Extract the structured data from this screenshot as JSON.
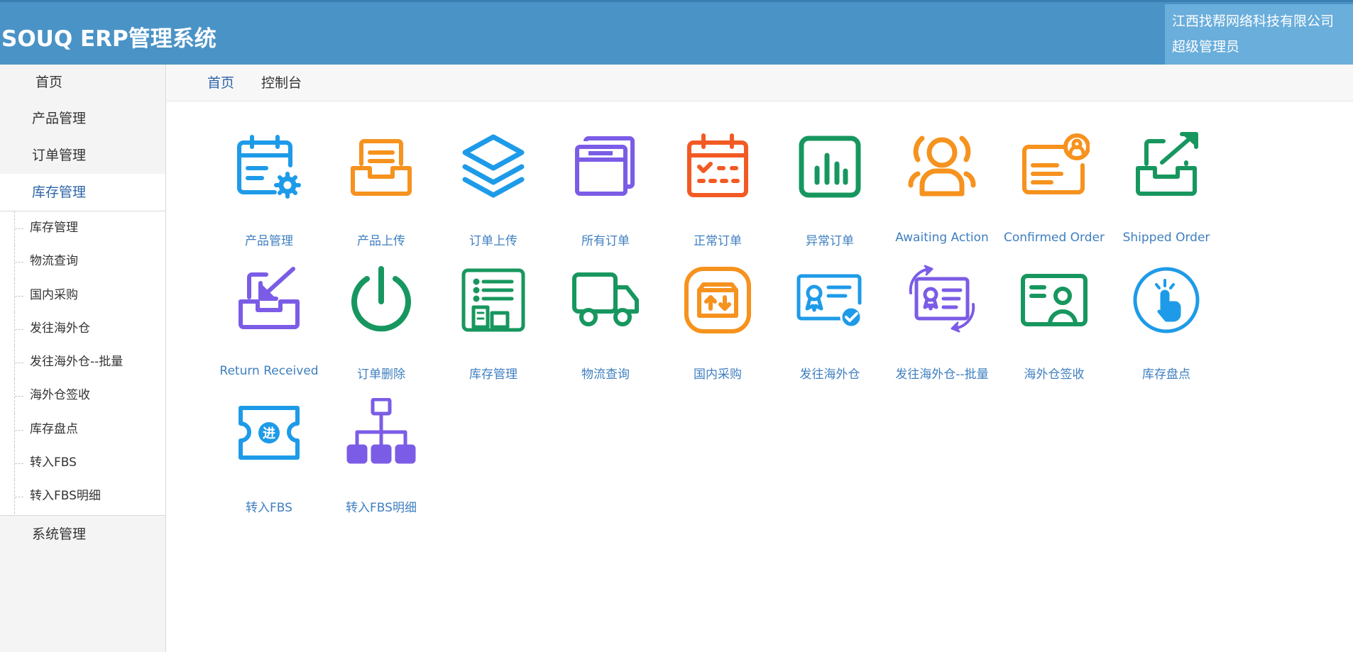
{
  "header": {
    "title": "SOUQ ERP管理系统",
    "company": "江西找帮网络科技有限公司",
    "role": "超级管理员"
  },
  "sidebar": {
    "items": [
      {
        "label": "首页"
      },
      {
        "label": "产品管理"
      },
      {
        "label": "订单管理"
      },
      {
        "label": "库存管理"
      },
      {
        "label": "系统管理"
      }
    ],
    "submenu": [
      "库存管理",
      "物流查询",
      "国内采购",
      "发往海外仓",
      "发往海外仓--批量",
      "海外仓签收",
      "库存盘点",
      "转入FBS",
      "转入FBS明细"
    ]
  },
  "breadcrumb": {
    "home": "首页",
    "current": "控制台"
  },
  "tiles": [
    {
      "label": "产品管理",
      "icon": "calendar-gear-icon",
      "color": "#1e9be8"
    },
    {
      "label": "产品上传",
      "icon": "inbox-tray-icon",
      "color": "#f6921e"
    },
    {
      "label": "订单上传",
      "icon": "layers-icon",
      "color": "#1e9be8"
    },
    {
      "label": "所有订单",
      "icon": "windows-stack-icon",
      "color": "#7b5ce6"
    },
    {
      "label": "正常订单",
      "icon": "calendar-check-icon",
      "color": "#f25a24"
    },
    {
      "label": "异常订单",
      "icon": "bar-chart-icon",
      "color": "#17975f"
    },
    {
      "label": "Awaiting Action",
      "icon": "user-group-icon",
      "color": "#f6921e"
    },
    {
      "label": "Confirmed Order",
      "icon": "id-card-icon",
      "color": "#f6921e"
    },
    {
      "label": "Shipped Order",
      "icon": "outbox-arrow-icon",
      "color": "#17975f"
    },
    {
      "label": "Return Received",
      "icon": "inbox-arrow-icon",
      "color": "#7b5ce6"
    },
    {
      "label": "订单删除",
      "icon": "power-icon",
      "color": "#17975f"
    },
    {
      "label": "库存管理",
      "icon": "building-list-icon",
      "color": "#17975f"
    },
    {
      "label": "物流查询",
      "icon": "truck-icon",
      "color": "#17975f"
    },
    {
      "label": "国内采购",
      "icon": "box-arrows-icon",
      "color": "#f6921e"
    },
    {
      "label": "发往海外仓",
      "icon": "certificate-check-icon",
      "color": "#1e9be8"
    },
    {
      "label": "发往海外仓--批量",
      "icon": "certificate-sync-icon",
      "color": "#7b5ce6"
    },
    {
      "label": "海外仓签收",
      "icon": "profile-card-icon",
      "color": "#17975f"
    },
    {
      "label": "库存盘点",
      "icon": "tap-hand-icon",
      "color": "#1e9be8"
    },
    {
      "label": "转入FBS",
      "icon": "ticket-icon",
      "color": "#1e9be8"
    },
    {
      "label": "转入FBS明细",
      "icon": "org-chart-icon",
      "color": "#7b5ce6"
    }
  ]
}
